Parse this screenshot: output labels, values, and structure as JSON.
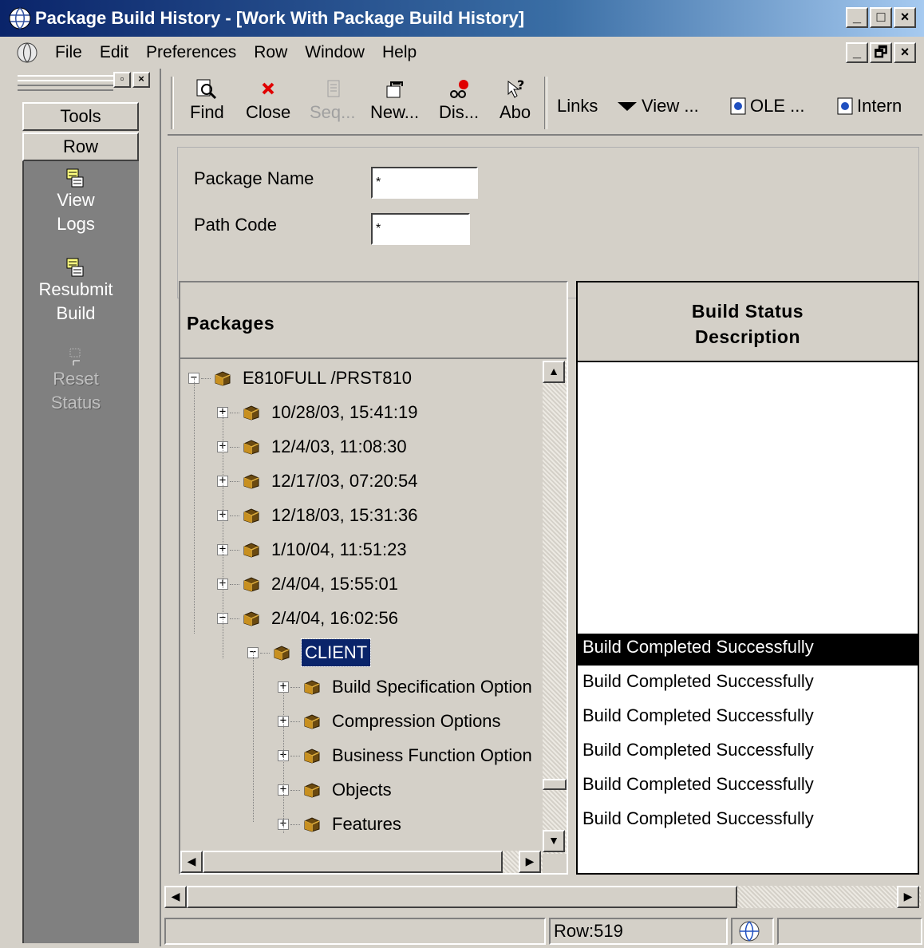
{
  "window": {
    "title": "Package Build History - [Work With Package Build History]",
    "controls": [
      "_",
      "□",
      "×"
    ],
    "inner_controls": [
      "_",
      "🗗",
      "×"
    ]
  },
  "menu": [
    "File",
    "Edit",
    "Preferences",
    "Row",
    "Window",
    "Help"
  ],
  "left_panel": {
    "tools_label": "Tools",
    "row_label": "Row",
    "actions": [
      {
        "label_line1": "View",
        "label_line2": "Logs",
        "icon": "view-logs-icon",
        "enabled": true
      },
      {
        "label_line1": "Resubmit",
        "label_line2": "Build",
        "icon": "resubmit-build-icon",
        "enabled": true
      },
      {
        "label_line1": "Reset",
        "label_line2": "Status",
        "icon": "reset-status-icon",
        "enabled": false
      }
    ]
  },
  "toolbar": {
    "buttons": [
      {
        "label": "Find",
        "icon": "find-icon",
        "enabled": true
      },
      {
        "label": "Close",
        "icon": "close-icon",
        "enabled": true
      },
      {
        "label": "Seq...",
        "icon": "sequence-icon",
        "enabled": false
      },
      {
        "label": "New...",
        "icon": "new-icon",
        "enabled": true
      },
      {
        "label": "Dis...",
        "icon": "display-icon",
        "enabled": true
      },
      {
        "label": "Abo",
        "icon": "about-icon",
        "enabled": true
      }
    ],
    "links_label": "Links",
    "view_label": "View ...",
    "ole_label": "OLE ...",
    "internet_label": "Intern"
  },
  "form": {
    "package_name_label": "Package Name",
    "package_name_value": "*",
    "path_code_label": "Path Code",
    "path_code_value": "*"
  },
  "tree": {
    "header": "Packages",
    "nodes": [
      {
        "label": "E810FULL /PRST810",
        "level": 0,
        "expanded": true
      },
      {
        "label": "10/28/03, 15:41:19",
        "level": 1,
        "expanded": false
      },
      {
        "label": "12/4/03, 11:08:30",
        "level": 1,
        "expanded": false
      },
      {
        "label": "12/17/03, 07:20:54",
        "level": 1,
        "expanded": false
      },
      {
        "label": "12/18/03, 15:31:36",
        "level": 1,
        "expanded": false
      },
      {
        "label": "1/10/04, 11:51:23",
        "level": 1,
        "expanded": false
      },
      {
        "label": "2/4/04, 15:55:01",
        "level": 1,
        "expanded": false
      },
      {
        "label": "2/4/04, 16:02:56",
        "level": 1,
        "expanded": true
      },
      {
        "label": "CLIENT",
        "level": 2,
        "expanded": true,
        "selected": true
      },
      {
        "label": "Build Specification Option",
        "level": 3,
        "expanded": false
      },
      {
        "label": "Compression Options",
        "level": 3,
        "expanded": false
      },
      {
        "label": "Business Function Option",
        "level": 3,
        "expanded": false
      },
      {
        "label": "Objects",
        "level": 3,
        "expanded": false
      },
      {
        "label": "Features",
        "level": 3,
        "expanded": false
      }
    ]
  },
  "grid": {
    "header_line1": "Build Status",
    "header_line2": "Description",
    "rows": [
      "Build Completed Successfully",
      "Build Completed Successfully",
      "Build Completed Successfully",
      "Build Completed Successfully",
      "Build Completed Successfully",
      "Build Completed Successfully"
    ]
  },
  "status": {
    "row_text": "Row:519"
  },
  "colors": {
    "titlebar": "#0a246a",
    "face": "#d4d0c8",
    "selection": "#0a246a",
    "left_panel_bg": "#808080"
  }
}
